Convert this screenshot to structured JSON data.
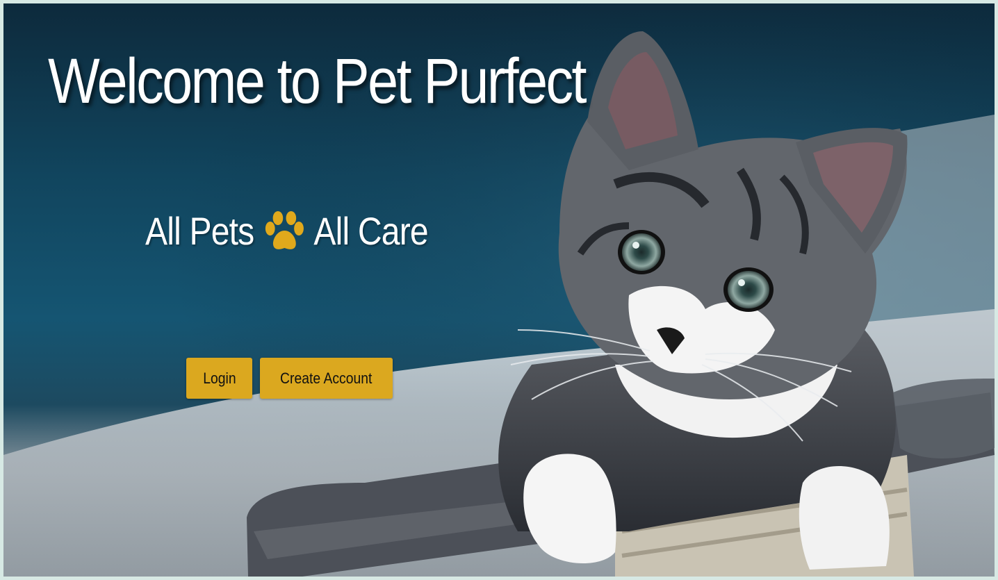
{
  "hero": {
    "title": "Welcome to Pet Purfect",
    "tagline_left": "All Pets",
    "tagline_icon": "paw-icon",
    "tagline_right": "All Care"
  },
  "actions": {
    "login_label": "Login",
    "create_account_label": "Create Account"
  },
  "colors": {
    "accent": "#dba81f",
    "paw": "#e0a91c",
    "background_teal": "#155572",
    "page_border": "#d7e9e4"
  }
}
